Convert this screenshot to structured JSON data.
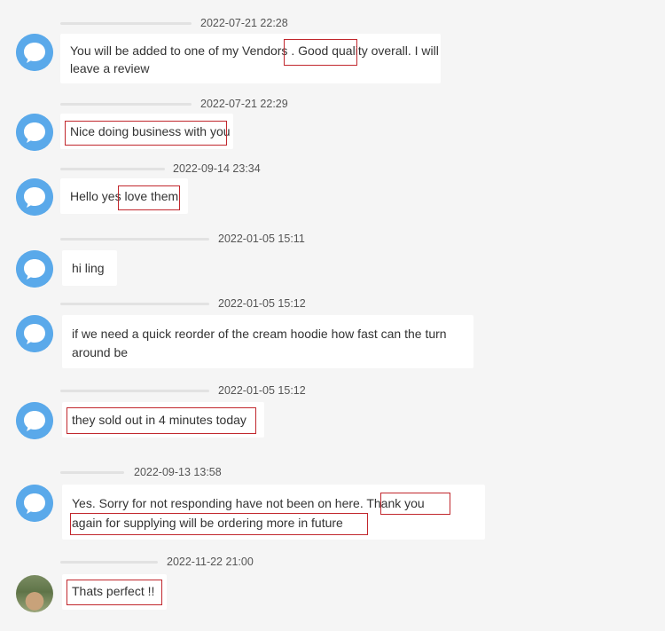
{
  "messages": [
    {
      "timestamp": "2022-07-21 22:28",
      "lines": [
        "You will be added to one of my Vendors . Good quality overall. I will",
        "leave a review"
      ]
    },
    {
      "timestamp": "2022-07-21 22:29",
      "lines": [
        "Nice doing business with you"
      ]
    },
    {
      "timestamp": "2022-09-14 23:34",
      "lines": [
        "Hello yes love them"
      ]
    },
    {
      "timestamp": "2022-01-05 15:11",
      "lines": [
        "hi ling"
      ]
    },
    {
      "timestamp": "2022-01-05 15:12",
      "lines": [
        "if we need a quick reorder of the cream hoodie how fast can the turn",
        "around be"
      ]
    },
    {
      "timestamp": "2022-01-05 15:12",
      "lines": [
        "they sold out in 4 minutes today"
      ]
    },
    {
      "timestamp": "2022-09-13 13:58",
      "lines": [
        "Yes. Sorry for not responding have not been on here. Thank you",
        "again for supplying will be ordering more in future"
      ]
    },
    {
      "timestamp": "2022-11-22 21:00",
      "lines": [
        "Thats perfect !!"
      ]
    }
  ],
  "colors": {
    "highlight": "#c1272d",
    "avatar": "#5aa9ea",
    "background": "#f5f5f5"
  }
}
